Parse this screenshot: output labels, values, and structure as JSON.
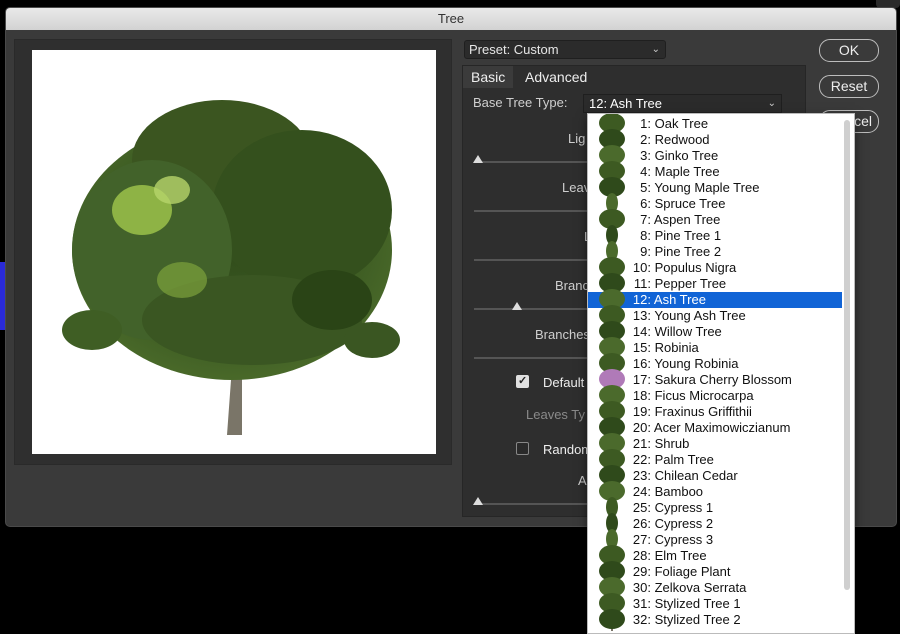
{
  "window": {
    "title": "Tree"
  },
  "preset": {
    "label": "Preset: Custom"
  },
  "buttons": {
    "ok": "OK",
    "reset": "Reset",
    "cancel": "cel"
  },
  "tabs": [
    {
      "label": "Basic"
    },
    {
      "label": "Advanced"
    }
  ],
  "base_tree": {
    "label": "Base Tree Type:",
    "value": "12: Ash Tree"
  },
  "controls": {
    "light": "Lig",
    "leaves": "Leav",
    "l": "L",
    "branch": "Branc",
    "branches": "Branches",
    "default": "Default",
    "leaves_type": "Leaves Ty",
    "random": "Random",
    "a": "A"
  },
  "tree_types": [
    "1: Oak Tree",
    "2: Redwood",
    "3: Ginko Tree",
    "4: Maple Tree",
    "5: Young Maple Tree",
    "6: Spruce Tree",
    "7: Aspen Tree",
    "8: Pine Tree 1",
    "9: Pine Tree 2",
    "10: Populus Nigra",
    "11: Pepper Tree",
    "12: Ash Tree",
    "13: Young Ash Tree",
    "14: Willow Tree",
    "15: Robinia",
    "16: Young Robinia",
    "17: Sakura Cherry Blossom",
    "18: Ficus Microcarpa",
    "19: Fraxinus Griffithii",
    "20: Acer Maximowiczianum",
    "21: Shrub",
    "22: Palm Tree",
    "23: Chilean Cedar",
    "24: Bamboo",
    "25: Cypress 1",
    "26: Cypress 2",
    "27: Cypress 3",
    "28: Elm Tree",
    "29: Foliage Plant",
    "30: Zelkova Serrata",
    "31: Stylized Tree 1",
    "32: Stylized Tree 2"
  ],
  "selected_index": 11,
  "colors": {
    "selection": "#1164d6",
    "foliage": "#3d5a22",
    "foliage_light": "#9bc24a",
    "trunk": "#7a7568",
    "blossom": "#b07ab8"
  },
  "icons": {
    "chevron": "chevron-updown-icon",
    "check": "checkmark-icon"
  }
}
